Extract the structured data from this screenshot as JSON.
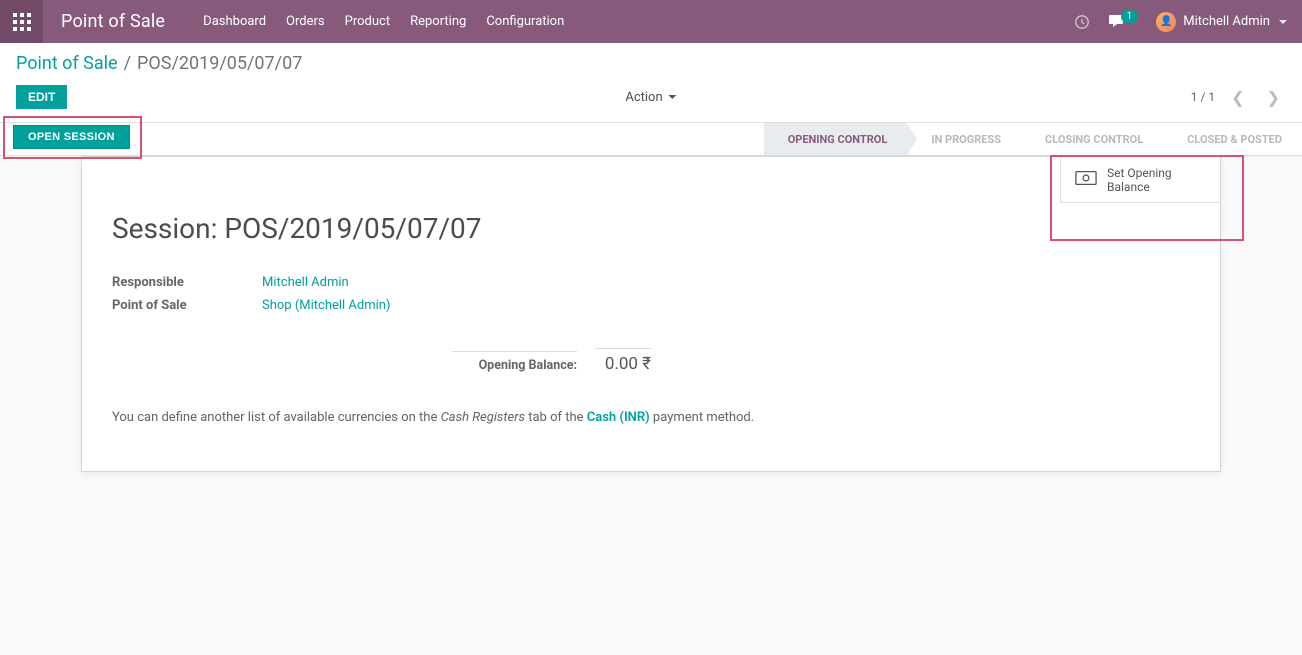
{
  "navbar": {
    "app_title": "Point of Sale",
    "menu": [
      "Dashboard",
      "Orders",
      "Product",
      "Reporting",
      "Configuration"
    ],
    "msg_count": "1",
    "user_name": "Mitchell Admin"
  },
  "breadcrumb": {
    "root": "Point of Sale",
    "sep": "/",
    "current": "POS/2019/05/07/07"
  },
  "buttons": {
    "edit": "EDIT",
    "open_session": "OPEN SESSION",
    "action": "Action",
    "set_opening_balance": "Set Opening Balance"
  },
  "pager": {
    "text": "1 / 1"
  },
  "status": {
    "steps": [
      "OPENING CONTROL",
      "IN PROGRESS",
      "CLOSING CONTROL",
      "CLOSED & POSTED"
    ]
  },
  "session": {
    "title": "Session: POS/2019/05/07/07",
    "responsible_label": "Responsible",
    "responsible_value": "Mitchell Admin",
    "pos_label": "Point of Sale",
    "pos_value": "Shop (Mitchell Admin)",
    "opening_balance_label": "Opening Balance:",
    "opening_balance_value": "0.00 ₹"
  },
  "note": {
    "a": "You can define another list of available currencies on the ",
    "b": "Cash Registers",
    "c": " tab of the ",
    "d": "Cash (INR)",
    "e": " payment method."
  }
}
